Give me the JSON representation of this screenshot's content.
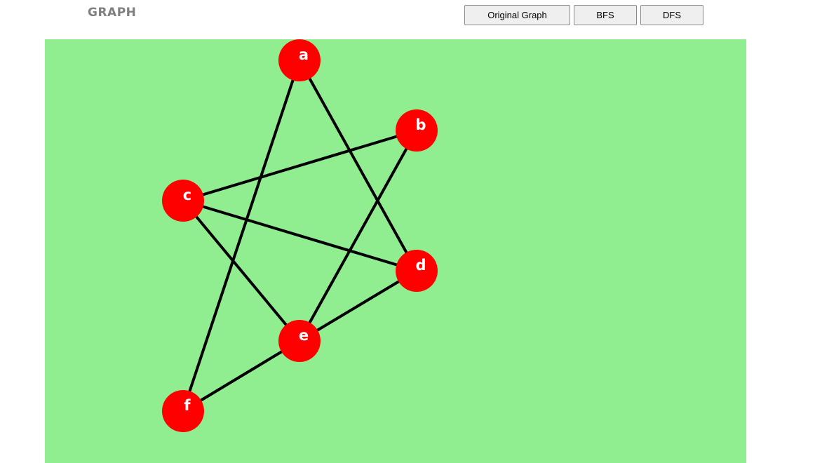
{
  "header": {
    "title": "GRAPH"
  },
  "toolbar": {
    "original_label": "Original Graph",
    "bfs_label": "BFS",
    "dfs_label": "DFS"
  },
  "graph": {
    "node_color": "#ff0000",
    "edge_color": "#000000",
    "canvas_color": "#90ee90",
    "nodes": [
      {
        "id": "a",
        "label": "a"
      },
      {
        "id": "b",
        "label": "b"
      },
      {
        "id": "c",
        "label": "c"
      },
      {
        "id": "d",
        "label": "d"
      },
      {
        "id": "e",
        "label": "e"
      },
      {
        "id": "f",
        "label": "f"
      }
    ],
    "edges": [
      [
        "a",
        "d"
      ],
      [
        "a",
        "f"
      ],
      [
        "b",
        "c"
      ],
      [
        "b",
        "e"
      ],
      [
        "c",
        "d"
      ],
      [
        "c",
        "e"
      ],
      [
        "d",
        "e"
      ],
      [
        "e",
        "f"
      ]
    ]
  }
}
